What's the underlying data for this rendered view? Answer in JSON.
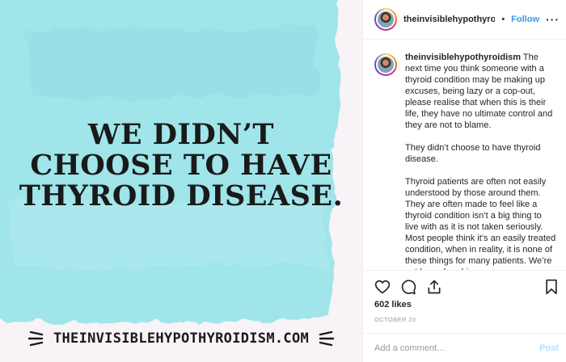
{
  "image": {
    "quote_lines": [
      "WE DIDN’T",
      "CHOOSE TO HAVE",
      "THYROID DISEASE."
    ],
    "url": "THEINVISIBLEHYPOTHYROIDISM.COM",
    "watercolor_color": "#9fe5ea",
    "background_color": "#f7f3f6"
  },
  "header": {
    "username": "theinvisiblehypothyroidi",
    "separator": "•",
    "follow_label": "Follow",
    "more_icon": "more-horizontal-icon"
  },
  "caption": {
    "username": "theinvisiblehypothyroidism",
    "paragraphs": [
      "The next time you think someone with a thyroid condition may be making up excuses, being lazy or a cop-out, please realise that when this is their life, they have no ultimate control and they are not to blame.",
      "They didn’t choose to have thyroid disease.",
      "Thyroid patients are often not easily understood by those around them. They are often made to feel like a thyroid condition isn’t a big thing to live with as it is not taken seriously. Most people think it’s an easily treated condition, when in reality, it is none of these things for many patients. We’re not hypochondriacs"
    ]
  },
  "actions": {
    "icons": [
      "heart-icon",
      "comment-icon",
      "share-icon",
      "bookmark-icon"
    ]
  },
  "likes": "602 likes",
  "date": "OCTOBER 23",
  "comment_box": {
    "placeholder": "Add a comment…",
    "post_label": "Post"
  },
  "colors": {
    "accent": "#3897f0",
    "post_disabled": "#b2dffc"
  }
}
